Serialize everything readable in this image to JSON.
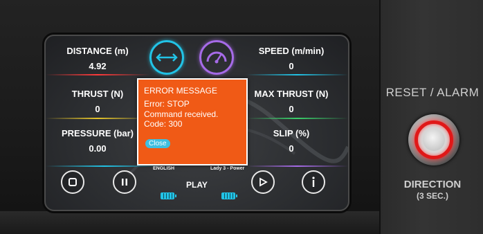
{
  "panel": {
    "title": "RESET / ALARM",
    "direction_label": "DIRECTION",
    "direction_hint": "(3 SEC.)"
  },
  "metrics": {
    "distance": {
      "label": "DISTANCE (m)",
      "value": "4.92"
    },
    "speed": {
      "label": "SPEED (m/min)",
      "value": "0"
    },
    "thrust": {
      "label": "THRUST (N)",
      "value": "0"
    },
    "max_thrust": {
      "label": "MAX THRUST (N)",
      "value": "0"
    },
    "pressure": {
      "label": "PRESSURE (bar)",
      "value": "0.00"
    },
    "slip": {
      "label": "SLIP (%)",
      "value": "0"
    }
  },
  "status": {
    "language": "ENGLISH",
    "profile": "Lady 3 - Power",
    "mode": "PLAY"
  },
  "error_dialog": {
    "title": "ERROR MESSAGE",
    "line1": "Error: STOP",
    "line2": "Command received.",
    "line3": "Code: 300",
    "close_label": "Close"
  },
  "icons": {
    "distance": "double-arrow-icon",
    "speed": "speedometer-icon",
    "stop": "stop-icon",
    "pause": "pause-icon",
    "play": "play-icon",
    "info": "info-icon",
    "battery": "battery-icon"
  },
  "colors": {
    "error_background": "#f05a16",
    "accent_blue": "#22c3e6",
    "accent_purple": "#a66be8",
    "alarm_red": "#e01818"
  }
}
